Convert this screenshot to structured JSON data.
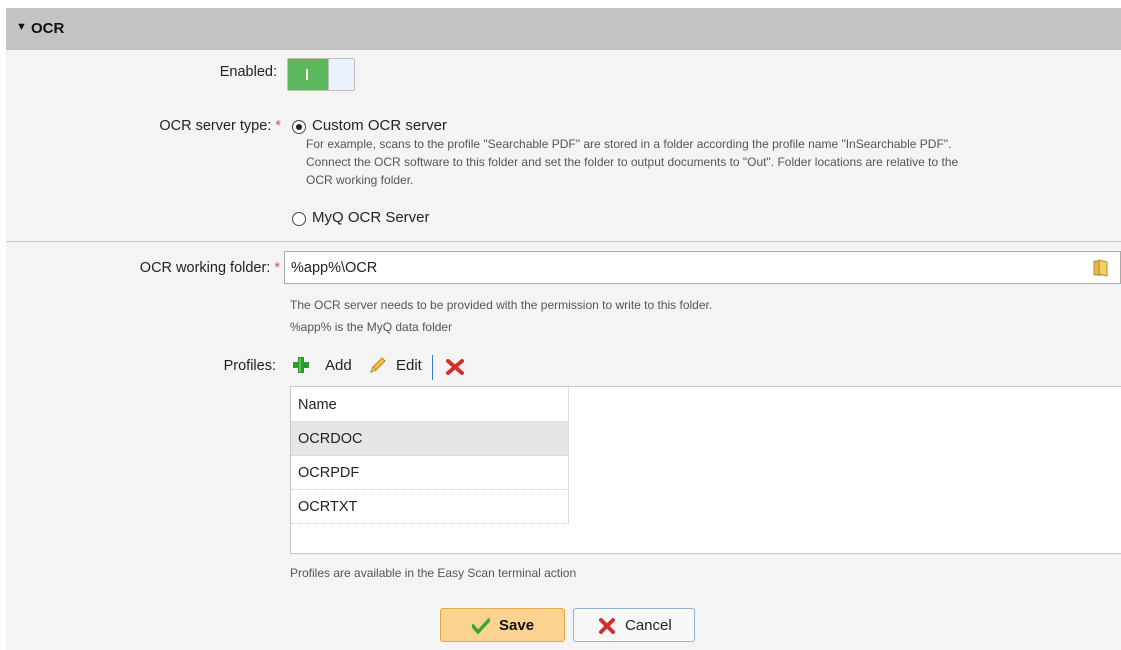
{
  "section": {
    "title": "OCR",
    "collapse_icon": "triangle-down-icon"
  },
  "enabled": {
    "label": "Enabled:",
    "value": true,
    "on_symbol": "I"
  },
  "server_type": {
    "label": "OCR server type:",
    "required_mark": "*",
    "options": [
      {
        "label": "Custom OCR server",
        "checked": true
      },
      {
        "label": "MyQ OCR Server",
        "checked": false
      }
    ],
    "description_lines": [
      "For example, scans to the profile \"Searchable PDF\" are stored in a folder according the profile name \"InSearchable PDF\".",
      "Connect the OCR software to this folder and set the folder to output documents to \"Out\". Folder locations are relative to the",
      "OCR working folder."
    ]
  },
  "working_folder": {
    "label": "OCR working folder:",
    "required_mark": "*",
    "value": "%app%\\OCR",
    "hints": [
      "The OCR server needs to be provided with the permission to write to this folder.",
      "%app% is the MyQ data folder"
    ]
  },
  "profiles": {
    "label": "Profiles:",
    "toolbar": {
      "add_label": "Add",
      "edit_label": "Edit"
    },
    "column_header": "Name",
    "rows": [
      "OCRDOC",
      "OCRPDF",
      "OCRTXT"
    ],
    "selected_index": 0,
    "hint": "Profiles are available in the Easy Scan terminal action"
  },
  "buttons": {
    "save_label": "Save",
    "cancel_label": "Cancel"
  },
  "colors": {
    "accent_green": "#5cb85c",
    "required_red": "#d9534f",
    "save_bg": "#fbd28f",
    "header_bg": "#c3c3c3"
  }
}
